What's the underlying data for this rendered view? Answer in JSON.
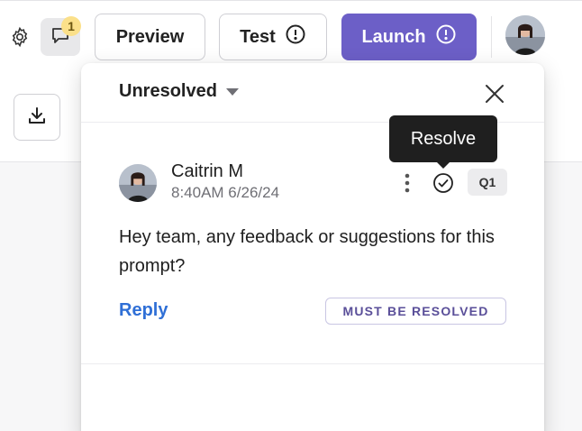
{
  "toolbar": {
    "notification_count": "1",
    "preview_label": "Preview",
    "test_label": "Test",
    "launch_label": "Launch",
    "launch_color": "#6c5fc7",
    "icons": [
      "gear-icon",
      "comment-icon",
      "alert-circle-icon",
      "avatar",
      "download-icon"
    ]
  },
  "panel": {
    "filter_label": "Unresolved",
    "close_icon": "close-icon",
    "tooltip": "Resolve",
    "comment": {
      "author": "Caitrin M",
      "timestamp": "8:40AM 6/26/24",
      "tag": "Q1",
      "body": "Hey team, any feedback or suggestions for this prompt?",
      "reply_label": "Reply",
      "status_badge": "MUST BE RESOLVED"
    }
  }
}
